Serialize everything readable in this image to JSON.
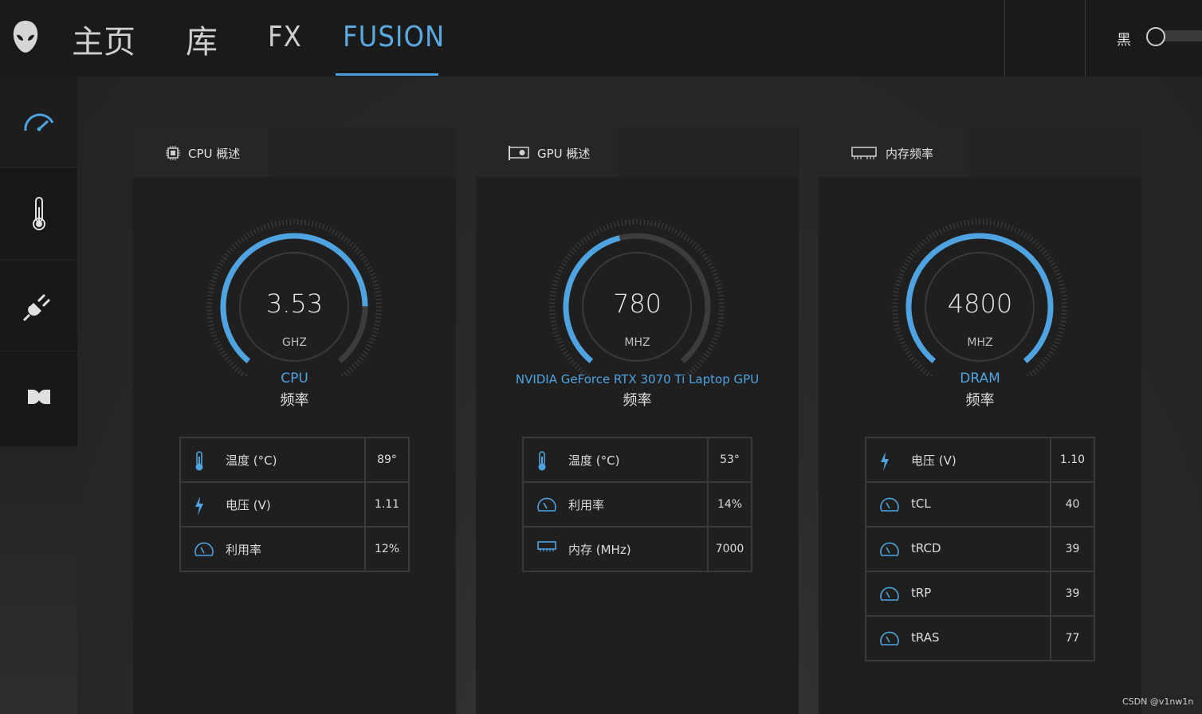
{
  "nav": {
    "tabs": [
      {
        "label": "主页"
      },
      {
        "label": "库"
      },
      {
        "label": "FX"
      },
      {
        "label": "FUSION"
      }
    ]
  },
  "theme": {
    "label": "黑"
  },
  "cards": [
    {
      "title": "CPU 概述",
      "gauge": {
        "value": "3.53",
        "unit": "GHZ",
        "fill_fraction": 0.82,
        "label": "CPU",
        "sub": "频率"
      },
      "rows": [
        {
          "icon": "thermometer-icon",
          "name": "温度 (°C)",
          "value": "89°"
        },
        {
          "icon": "lightning-icon",
          "name": "电压 (V)",
          "value": "1.11"
        },
        {
          "icon": "gauge-icon",
          "name": "利用率",
          "value": "12%"
        }
      ]
    },
    {
      "title": "GPU 概述",
      "gauge": {
        "value": "780",
        "unit": "MHZ",
        "fill_fraction": 0.45,
        "label": "NVIDIA GeForce RTX 3070 Ti Laptop GPU",
        "sub": "频率"
      },
      "rows": [
        {
          "icon": "thermometer-icon",
          "name": "温度 (°C)",
          "value": "53°"
        },
        {
          "icon": "gauge-icon",
          "name": "利用率",
          "value": "14%"
        },
        {
          "icon": "memory-icon",
          "name": "内存 (MHz)",
          "value": "7000"
        }
      ]
    },
    {
      "title": "内存频率",
      "gauge": {
        "value": "4800",
        "unit": "MHZ",
        "fill_fraction": 1.0,
        "label": "DRAM",
        "sub": "频率"
      },
      "rows": [
        {
          "icon": "lightning-icon",
          "name": "电压 (V)",
          "value": "1.10"
        },
        {
          "icon": "gauge-icon",
          "name": "tCL",
          "value": "40"
        },
        {
          "icon": "gauge-icon",
          "name": "tRCD",
          "value": "39"
        },
        {
          "icon": "gauge-icon",
          "name": "tRP",
          "value": "39"
        },
        {
          "icon": "gauge-icon",
          "name": "tRAS",
          "value": "77"
        }
      ]
    }
  ],
  "watermark": "CSDN @v1nw1n",
  "colors": {
    "accent": "#4fa3e0",
    "track": "#3c3c3c"
  }
}
